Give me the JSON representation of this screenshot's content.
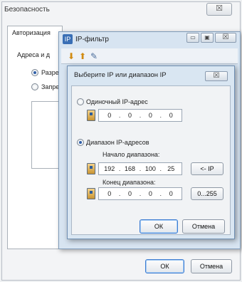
{
  "security_window": {
    "title": "Безопасность",
    "close_glyph": "☒",
    "tab_label": "Авторизация",
    "address_label": "Адреса и д",
    "radio_allow": "Разре",
    "radio_deny": "Запре",
    "ok_label": "ОК",
    "cancel_label": "Отмена"
  },
  "ip_filter_window": {
    "title": "IP-фильтр",
    "min_glyph": "▭",
    "max_glyph": "▣",
    "close_glyph": "☒",
    "toolbar_icons": [
      "add-icon",
      "remove-icon",
      "edit-icon"
    ]
  },
  "dialog": {
    "title": "Выберите IP или диапазон IP",
    "close_glyph": "☒",
    "single_label": "Одиночный IP-адрес",
    "single_ip": [
      "0",
      "0",
      "0",
      "0"
    ],
    "range_label": "Диапазон IP-адресов",
    "range_start_label": "Начало диапазона:",
    "range_start_ip": [
      "192",
      "168",
      "100",
      "25"
    ],
    "copy_ip_button": "<- IP",
    "range_end_label": "Конец диапазона:",
    "range_end_ip": [
      "0",
      "0",
      "0",
      "0"
    ],
    "range_255_button": "0...255",
    "ok_label": "ОК",
    "cancel_label": "Отмена",
    "selected_option": "range"
  }
}
